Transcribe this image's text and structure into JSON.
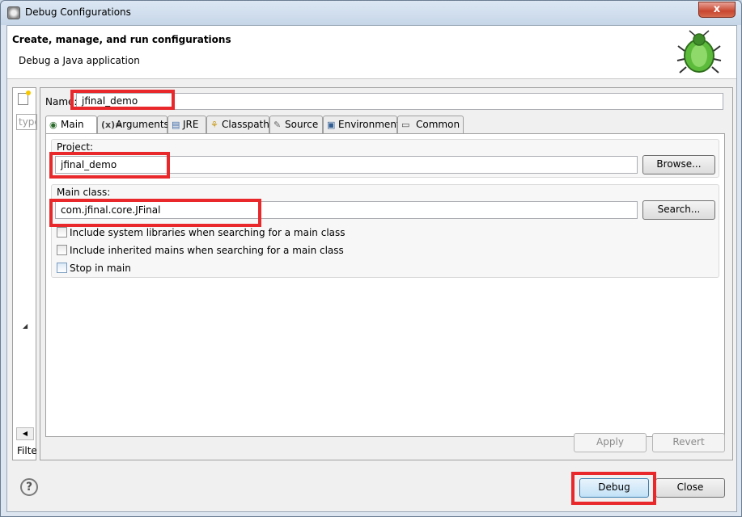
{
  "window": {
    "title": "Debug Configurations",
    "close_glyph": "x"
  },
  "header": {
    "title": "Create, manage, and run configurations",
    "subtitle": "Debug a Java application"
  },
  "left_pane": {
    "filter_placeholder": "type",
    "filter_label": "Filte"
  },
  "config": {
    "name_label": "Name:",
    "name_value": "jfinal_demo"
  },
  "tabs": [
    {
      "label": "Main",
      "icon": "main-icon"
    },
    {
      "label": "Arguments",
      "icon": "arguments-icon"
    },
    {
      "label": "JRE",
      "icon": "jre-icon"
    },
    {
      "label": "Classpath",
      "icon": "classpath-icon"
    },
    {
      "label": "Source",
      "icon": "source-icon"
    },
    {
      "label": "Environment",
      "icon": "environment-icon"
    },
    {
      "label": "Common",
      "icon": "common-icon"
    }
  ],
  "main_tab": {
    "project_label": "Project:",
    "project_value": "jfinal_demo",
    "browse_label": "Browse...",
    "main_class_label": "Main class:",
    "main_class_value": "com.jfinal.core.JFinal",
    "search_label": "Search...",
    "checkboxes": [
      {
        "label": "Include system libraries when searching for a main class",
        "checked": false
      },
      {
        "label": "Include inherited mains when searching for a main class",
        "checked": false
      },
      {
        "label": "Stop in main",
        "checked": false
      }
    ]
  },
  "actions": {
    "apply_label": "Apply",
    "revert_label": "Revert",
    "debug_label": "Debug",
    "close_label": "Close",
    "help_glyph": "?"
  },
  "colors": {
    "highlight": "#e8282b"
  }
}
